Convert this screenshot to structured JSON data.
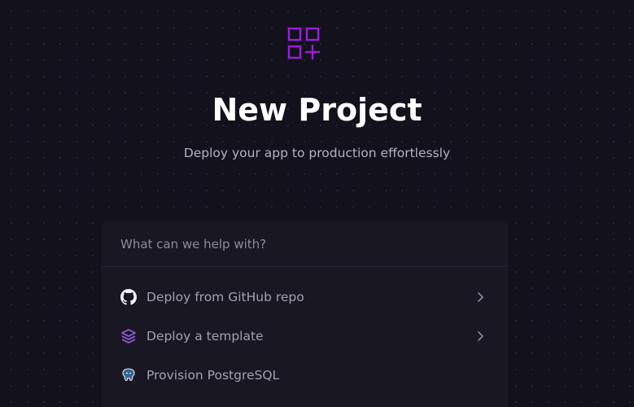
{
  "header": {
    "logo_icon": "grid-plus-icon",
    "title": "New Project",
    "subtitle": "Deploy your app to production effortlessly"
  },
  "search": {
    "placeholder": "What can we help with?",
    "value": ""
  },
  "options": [
    {
      "label": "Deploy from GitHub repo",
      "icon": "github-icon",
      "has_chevron": true
    },
    {
      "label": "Deploy a template",
      "icon": "layers-icon",
      "has_chevron": true
    },
    {
      "label": "Provision PostgreSQL",
      "icon": "postgresql-icon",
      "has_chevron": false
    }
  ],
  "colors": {
    "background": "#13111c",
    "card": "#191722",
    "accent": "#9b1fd9",
    "title": "#ffffff",
    "subtitle": "#b5b1c2",
    "option_text": "#a4a0b1",
    "placeholder": "#8e8a9c"
  }
}
